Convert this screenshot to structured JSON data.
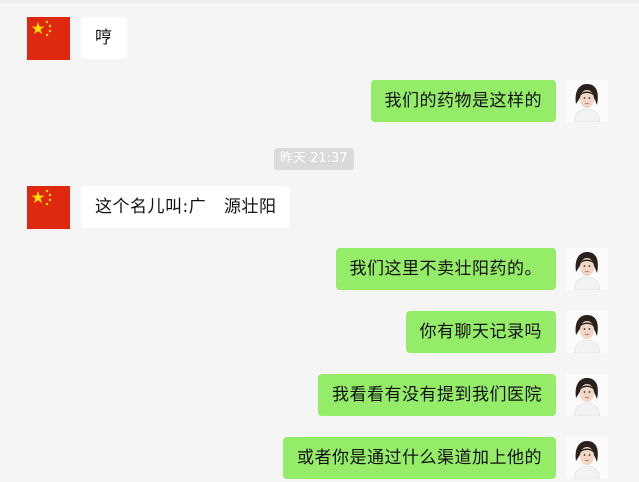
{
  "colors": {
    "background": "#f5f5f5",
    "sent_bubble": "#95ec69",
    "received_bubble": "#ffffff",
    "timestamp_bg": "#dadada"
  },
  "chat": {
    "messages": [
      {
        "side": "left",
        "avatar": "china-flag-icon",
        "text": "哼"
      },
      {
        "side": "right",
        "avatar": "woman-avatar-icon",
        "text": "我们的药物是这样的"
      },
      {
        "type": "timestamp",
        "text": "昨天 21:37"
      },
      {
        "side": "left",
        "avatar": "china-flag-icon",
        "text": "这个名儿叫:广   源壮阳"
      },
      {
        "side": "right",
        "avatar": "woman-avatar-icon",
        "text": "我们这里不卖壮阳药的。"
      },
      {
        "side": "right",
        "avatar": "woman-avatar-icon",
        "text": "你有聊天记录吗"
      },
      {
        "side": "right",
        "avatar": "woman-avatar-icon",
        "text": "我看看有没有提到我们医院"
      },
      {
        "side": "right",
        "avatar": "woman-avatar-icon",
        "text": "或者你是通过什么渠道加上他的"
      }
    ]
  }
}
